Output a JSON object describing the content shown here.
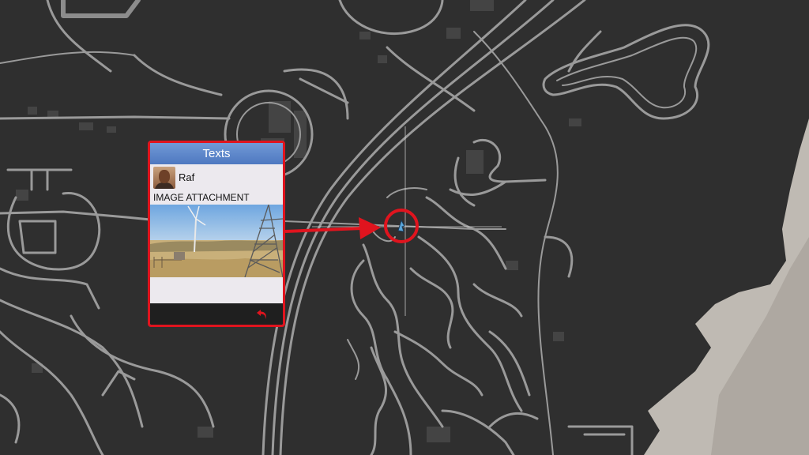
{
  "map": {
    "background_color": "#2f2f2f",
    "road_color": "#9a9a9a",
    "building_color": "#444444",
    "terrain_color": "#cfcac2"
  },
  "phone": {
    "header_title": "Texts",
    "contact_name": "Raf",
    "attachment_label": "IMAGE ATTACHMENT",
    "avatar_icon": "contact-avatar",
    "back_icon": "back-arrow-icon",
    "accent_color": "#e0141e",
    "header_color": "#5b84c8"
  },
  "marker": {
    "icon": "blip-marker-icon",
    "ring_color": "#e0141e"
  }
}
